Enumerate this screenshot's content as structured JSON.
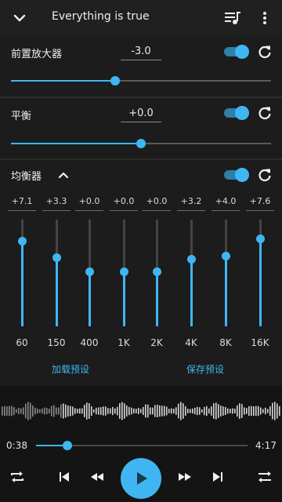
{
  "header": {
    "title": "Everything is true",
    "collapse_icon": "chevron-down-icon",
    "queue_icon": "queue-music-icon",
    "more_icon": "more-vert-icon"
  },
  "preamp": {
    "label": "前置放大器",
    "value": "-3.0",
    "enabled": true,
    "slider_level": 0.4
  },
  "balance": {
    "label": "平衡",
    "value": "+0.0",
    "enabled": true,
    "slider_level": 0.5
  },
  "equalizer": {
    "label": "均衡器",
    "enabled": true,
    "bands": [
      {
        "value": "+7.1",
        "freq": "60",
        "level": 0.8
      },
      {
        "value": "+3.3",
        "freq": "150",
        "level": 0.64
      },
      {
        "value": "+0.0",
        "freq": "400",
        "level": 0.51
      },
      {
        "value": "+0.0",
        "freq": "1K",
        "level": 0.51
      },
      {
        "value": "+0.0",
        "freq": "2K",
        "level": 0.51
      },
      {
        "value": "+3.2",
        "freq": "4K",
        "level": 0.63
      },
      {
        "value": "+4.0",
        "freq": "8K",
        "level": 0.66
      },
      {
        "value": "+7.6",
        "freq": "16K",
        "level": 0.82
      }
    ],
    "load_preset": "加载预设",
    "save_preset": "保存预设"
  },
  "player": {
    "elapsed": "0:38",
    "duration": "4:17",
    "progress": 0.148
  },
  "colors": {
    "accent": "#3fb6f2",
    "background": "#1c1c1c"
  }
}
